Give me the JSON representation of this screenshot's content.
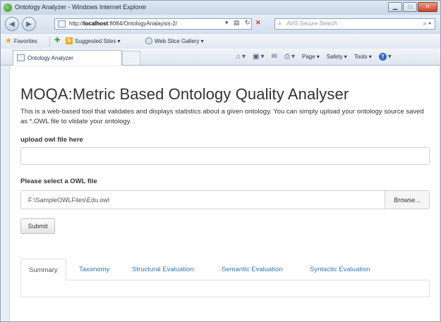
{
  "window": {
    "title": "Ontology Analyzer - Windows Internet Explorer",
    "address": {
      "url_prefix": "http://",
      "host": "localhost",
      "url_rest": ":8084/OntologyAnalaysis-2/"
    },
    "search_placeholder": "AVG Secure Search"
  },
  "favorites_bar": {
    "favorites_label": "Favorites",
    "suggested_sites_label": "Suggested Sites ▾",
    "web_slice_label": "Web Slice Gallery ▾"
  },
  "tab": {
    "label": "Ontology Analyzer"
  },
  "command_bar": {
    "page_label": "Page ▾",
    "safety_label": "Safety ▾",
    "tools_label": "Tools ▾"
  },
  "page": {
    "title": "MOQA:Metric Based Ontology Quality Analyser",
    "description": "This is a web-based tool that validates and displays statistics about a given ontology. You can simply upload your ontology source saved as *.OWL file to vlidate your ontology. .",
    "upload_label": "upload owl file here",
    "select_label": "Please select a OWL file",
    "file_path": "F:\\SampleOWLFiles\\Edu.owl",
    "browse_label": "Browse...",
    "submit_label": "Submit",
    "result_tabs": [
      {
        "label": "Summary"
      },
      {
        "label": "Taxonomy"
      },
      {
        "label": "Structural Evaluation"
      },
      {
        "label": "Semantic Evaluation"
      },
      {
        "label": "Syntactic Evaluation"
      }
    ],
    "active_tab": "Summary"
  },
  "colors": {
    "link": "#337ab7",
    "text": "#333333",
    "border": "#ccd1d8"
  }
}
